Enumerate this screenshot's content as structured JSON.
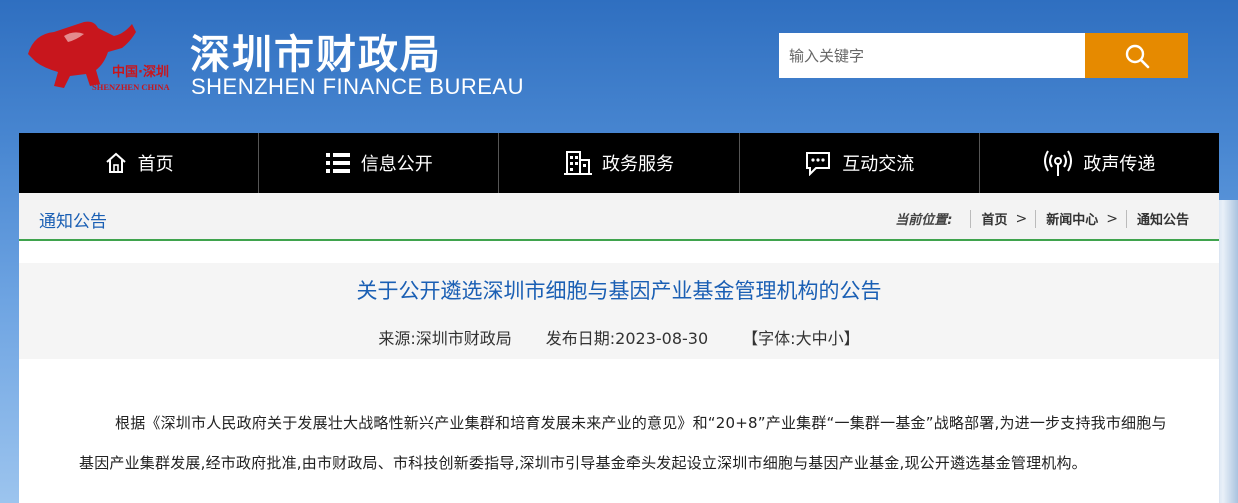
{
  "header": {
    "logo_text_cn": "中国·深圳",
    "logo_text_en": "SHENZHEN CHINA",
    "title": "深圳市财政局",
    "subtitle": "SHENZHEN FINANCE BUREAU",
    "search_placeholder": "输入关键字",
    "search_icon": "search-icon",
    "accent_color": "#e68a00"
  },
  "nav": {
    "items": [
      {
        "label": "首页",
        "icon": "home-icon"
      },
      {
        "label": "信息公开",
        "icon": "list-icon"
      },
      {
        "label": "政务服务",
        "icon": "building-icon"
      },
      {
        "label": "互动交流",
        "icon": "chat-icon"
      },
      {
        "label": "政声传递",
        "icon": "broadcast-icon"
      }
    ]
  },
  "breadcrumb": {
    "section": "通知公告",
    "label": "当前位置:",
    "items": [
      "首页",
      "新闻中心",
      "通知公告"
    ]
  },
  "article": {
    "title": "关于公开遴选深圳市细胞与基因产业基金管理机构的公告",
    "source": "来源:深圳市财政局",
    "date": "发布日期:2023-08-30",
    "font_label": "【字体:",
    "font_large": "大",
    "font_medium": "中",
    "font_small": "小",
    "font_close": "】",
    "body": "根据《深圳市人民政府关于发展壮大战略性新兴产业集群和培育发展未来产业的意见》和“20+8”产业集群“一集群一基金”战略部署,为进一步支持我市细胞与基因产业集群发展,经市政府批准,由市财政局、市科技创新委指导,深圳市引导基金牵头发起设立深圳市细胞与基因产业基金,现公开遴选基金管理机构。"
  }
}
